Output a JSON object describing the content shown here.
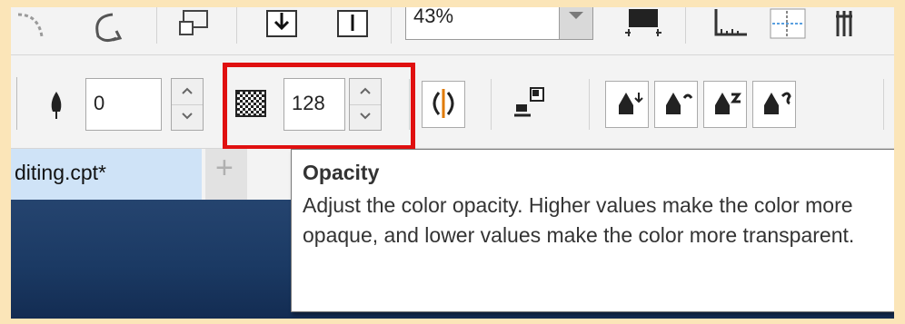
{
  "toolbar_top": {
    "zoom_value": "43%"
  },
  "toolbar_props": {
    "feather_value": "0",
    "opacity_value": "128"
  },
  "document_tab": {
    "label": "diting.cpt*",
    "add_label": "+"
  },
  "tooltip": {
    "title": "Opacity",
    "body": "Adjust the color opacity. Higher values make the color more opaque, and lower values make the color more transparent."
  },
  "colors": {
    "highlight": "#e01010",
    "tab_active": "#cfe3f7",
    "canvas": "#1b3a64"
  }
}
